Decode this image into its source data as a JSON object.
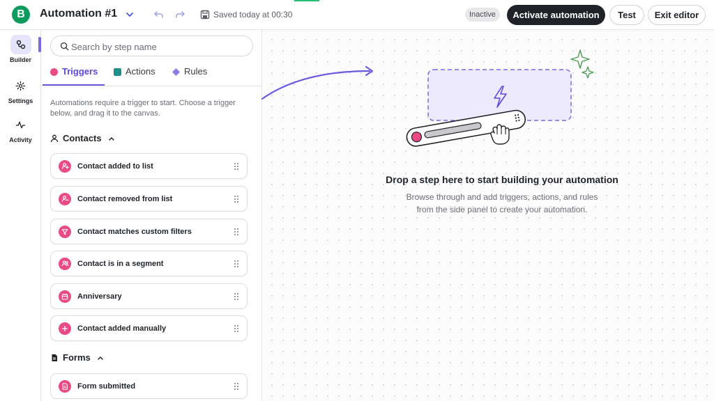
{
  "header": {
    "logo_letter": "B",
    "title": "Automation #1",
    "saved_text": "Saved today at 00:30",
    "status_badge": "Inactive",
    "activate_label": "Activate automation",
    "test_label": "Test",
    "exit_label": "Exit editor"
  },
  "rail": {
    "items": [
      {
        "label": "Builder",
        "icon": "workflow-icon",
        "active": true
      },
      {
        "label": "Settings",
        "icon": "gear-icon",
        "active": false
      },
      {
        "label": "Activity",
        "icon": "pulse-icon",
        "active": false
      }
    ]
  },
  "panel": {
    "search_placeholder": "Search by step name",
    "tabs": [
      {
        "label": "Triggers",
        "color": "#e94b86",
        "active": true
      },
      {
        "label": "Actions",
        "color": "#1f8f8a",
        "active": false
      },
      {
        "label": "Rules",
        "color": "#8a7be8",
        "active": false
      }
    ],
    "hint": "Automations require a trigger to start. Choose a trigger below, and drag it to the canvas.",
    "sections": [
      {
        "title": "Contacts",
        "icon": "person-icon"
      },
      {
        "title": "Forms",
        "icon": "document-icon"
      }
    ],
    "contact_triggers": [
      {
        "label": "Contact added to list",
        "icon": "user-plus-icon"
      },
      {
        "label": "Contact removed from list",
        "icon": "user-minus-icon"
      },
      {
        "label": "Contact matches custom filters",
        "icon": "filter-icon"
      },
      {
        "label": "Contact is in a segment",
        "icon": "users-icon"
      },
      {
        "label": "Anniversary",
        "icon": "calendar-icon"
      },
      {
        "label": "Contact added manually",
        "icon": "plus-icon"
      }
    ],
    "form_triggers": [
      {
        "label": "Form submitted",
        "icon": "form-icon"
      }
    ]
  },
  "canvas": {
    "drop_title": "Drop a step here to start building your automation",
    "drop_subtitle_line1": "Browse through and add triggers, actions, and rules",
    "drop_subtitle_line2": "from the side panel to create your automation."
  },
  "colors": {
    "brand": "#0b9b5c",
    "trigger": "#e94b86",
    "accent": "#6a5ae0"
  }
}
